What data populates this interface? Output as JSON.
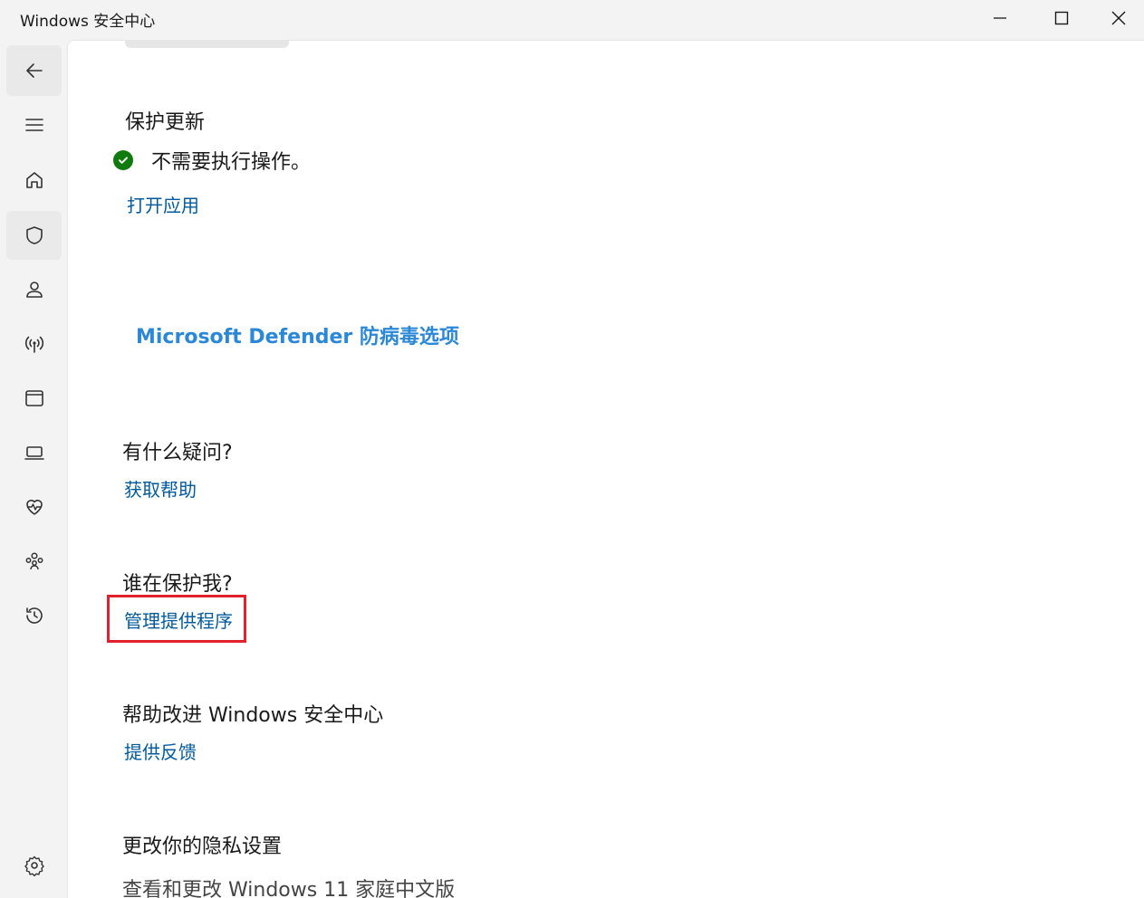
{
  "window": {
    "title": "Windows 安全中心"
  },
  "nav": {
    "items": [
      {
        "icon": "back-arrow-icon"
      },
      {
        "icon": "hamburger-menu-icon"
      },
      {
        "icon": "home-icon"
      },
      {
        "icon": "shield-icon",
        "active": true
      },
      {
        "icon": "account-person-icon"
      },
      {
        "icon": "wifi-antenna-icon"
      },
      {
        "icon": "app-browser-window-icon"
      },
      {
        "icon": "laptop-device-icon"
      },
      {
        "icon": "heart-pulse-icon"
      },
      {
        "icon": "family-people-icon"
      },
      {
        "icon": "history-clock-icon"
      },
      {
        "icon": "settings-gear-icon"
      }
    ],
    "accent_color": "#005fb8"
  },
  "sections": {
    "protection_updates": {
      "title": "保护更新",
      "status_text": "不需要执行操作。",
      "status_color": "#0f7b0f",
      "link": "打开应用"
    },
    "defender_options": {
      "link": "Microsoft Defender 防病毒选项"
    },
    "questions": {
      "title": "有什么疑问?",
      "link": "获取帮助"
    },
    "who_protects": {
      "title": "谁在保护我?",
      "link": "管理提供程序",
      "highlight_color": "#e3202e"
    },
    "improve": {
      "title": "帮助改进 Windows 安全中心",
      "link": "提供反馈"
    },
    "privacy": {
      "title": "更改你的隐私设置",
      "text": "查看和更改 Windows 11 家庭中文版"
    }
  }
}
